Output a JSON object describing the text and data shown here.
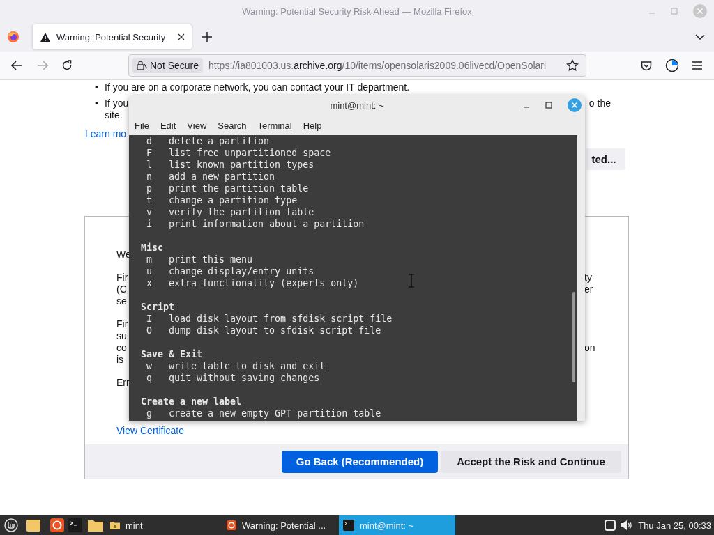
{
  "browser": {
    "window_title": "Warning: Potential Security Risk Ahead — Mozilla Firefox",
    "tabs": [
      {
        "title": "Warning: Potential Security",
        "selected": true
      }
    ],
    "address": {
      "security": "Not Secure",
      "url_start": "https://ia801003.us.",
      "url_domain": "archive.org",
      "url_end": "/10/items/opensolaris2009.06livecd/OpenSolari"
    }
  },
  "page": {
    "bullets": [
      {
        "marker": "•",
        "left": "If you are on a corporate network, you can contact your IT department."
      },
      {
        "marker": "•",
        "left": "If you",
        "right": "o the",
        "cont": "site."
      }
    ],
    "learn_more": "Learn mo",
    "advanced_button": "ted...",
    "details": [
      {
        "lines": [
          {
            "left": "We"
          }
        ]
      },
      {
        "lines": [
          {
            "left": "Fir",
            "right": "ty"
          },
          {
            "left": "(C",
            "right": "er"
          },
          {
            "left": "se"
          }
        ]
      },
      {
        "lines": [
          {
            "left": "Fir"
          },
          {
            "left": "su"
          },
          {
            "left": "co",
            "right": "on"
          },
          {
            "left": "is"
          }
        ]
      },
      {
        "lines": [
          {
            "left": "Err"
          }
        ]
      }
    ],
    "view_certificate": "View Certificate",
    "buttons": [
      {
        "label": "Go Back (Recommended)",
        "kind": "primary"
      },
      {
        "label": "Accept the Risk and Continue",
        "kind": "secondary"
      }
    ]
  },
  "terminal": {
    "title": "mint@mint: ~",
    "menu": [
      "File",
      "Edit",
      "View",
      "Search",
      "Terminal",
      "Help"
    ],
    "lines": [
      {
        "kind": "command",
        "key": "d",
        "text": "delete a partition"
      },
      {
        "kind": "command",
        "key": "F",
        "text": "list free unpartitioned space"
      },
      {
        "kind": "command",
        "key": "l",
        "text": "list known partition types"
      },
      {
        "kind": "command",
        "key": "n",
        "text": "add a new partition"
      },
      {
        "kind": "command",
        "key": "p",
        "text": "print the partition table"
      },
      {
        "kind": "command",
        "key": "t",
        "text": "change a partition type"
      },
      {
        "kind": "command",
        "key": "v",
        "text": "verify the partition table"
      },
      {
        "kind": "command",
        "key": "i",
        "text": "print information about a partition"
      },
      {
        "kind": "heading",
        "text": "Misc"
      },
      {
        "kind": "command",
        "key": "m",
        "text": "print this menu"
      },
      {
        "kind": "command",
        "key": "u",
        "text": "change display/entry units"
      },
      {
        "kind": "command",
        "key": "x",
        "text": "extra functionality (experts only)"
      },
      {
        "kind": "heading",
        "text": "Script"
      },
      {
        "kind": "command",
        "key": "I",
        "text": "load disk layout from sfdisk script file"
      },
      {
        "kind": "command",
        "key": "O",
        "text": "dump disk layout to sfdisk script file"
      },
      {
        "kind": "heading",
        "text": "Save & Exit"
      },
      {
        "kind": "command",
        "key": "w",
        "text": "write table to disk and exit"
      },
      {
        "kind": "command",
        "key": "q",
        "text": "quit without saving changes"
      },
      {
        "kind": "heading",
        "text": "Create a new label"
      },
      {
        "kind": "command",
        "key": "g",
        "text": "create a new empty GPT partition table"
      }
    ]
  },
  "taskbar": {
    "windows": [
      {
        "label": "mint",
        "kind": "folder",
        "selected": false
      },
      {
        "label": "Warning: Potential ...",
        "kind": "browser",
        "selected": false
      },
      {
        "label": "mint@mint: ~",
        "kind": "terminal",
        "selected": true
      }
    ],
    "clock": "Thu Jan 25, 00:33"
  }
}
